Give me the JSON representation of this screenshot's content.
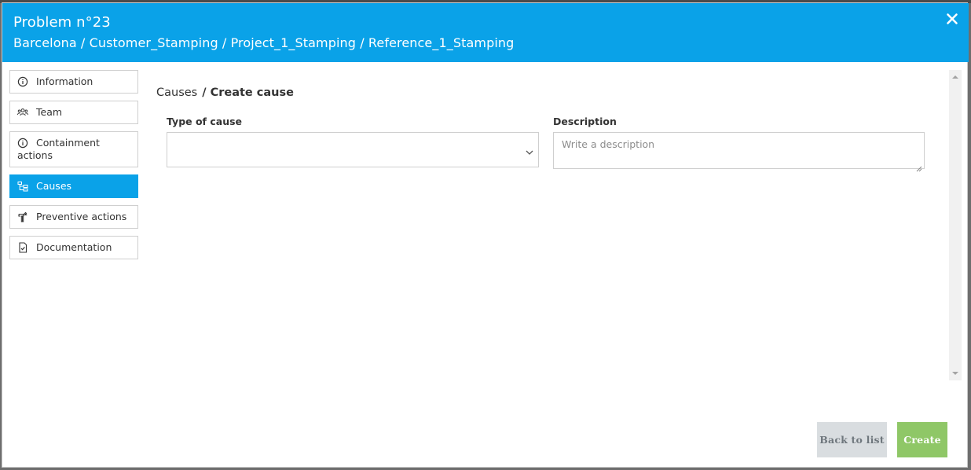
{
  "header": {
    "title": "Problem n°23",
    "path": "Barcelona / Customer_Stamping / Project_1_Stamping / Reference_1_Stamping",
    "close_icon": "close-icon"
  },
  "sidebar": {
    "items": [
      {
        "label": "Information",
        "icon": "info-icon",
        "active": false
      },
      {
        "label": "Team",
        "icon": "team-icon",
        "active": false
      },
      {
        "label": "Containment actions",
        "icon": "info-icon",
        "active": false
      },
      {
        "label": "Causes",
        "icon": "hierarchy-icon",
        "active": true
      },
      {
        "label": "Preventive actions",
        "icon": "hammer-icon",
        "active": false
      },
      {
        "label": "Documentation",
        "icon": "document-check-icon",
        "active": false
      }
    ]
  },
  "main": {
    "breadcrumb": {
      "parent": "Causes",
      "current": "/ Create cause"
    },
    "type_of_cause": {
      "label": "Type of cause",
      "value": ""
    },
    "description": {
      "label": "Description",
      "placeholder": "Write a description",
      "value": ""
    }
  },
  "footer": {
    "back_label": "Back to list",
    "create_label": "Create"
  },
  "colors": {
    "primary": "#0aa2e8",
    "create_button": "#8fc767",
    "back_button": "#d9dde0"
  }
}
